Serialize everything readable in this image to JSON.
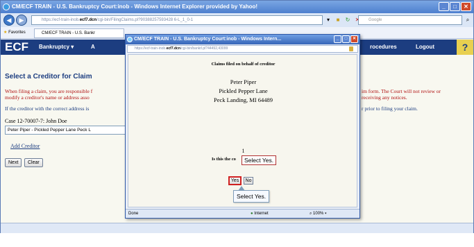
{
  "browser": {
    "title": "CM/ECF TRAIN - U.S. Bankruptcy Court:inob - Windows Internet Explorer provided by Yahoo!",
    "url_scheme": "https",
    "url_host": "ecf7.dcn",
    "url_rest": "/cgi-bin/FilingClaims.pl?90388257593428 6-L_1_0-1",
    "url_prefix": "://ecf-train-inob.",
    "search_placeholder": "Google",
    "favorites_label": "Favorites",
    "tab_label": "CM/ECF TRAIN - U.S. Bankr"
  },
  "ecf": {
    "logo": "ECF",
    "menu_bankruptcy": "Bankruptcy",
    "menu_adversary": "A",
    "menu_procedures": "rocedures",
    "menu_logout": "Logout",
    "help": "?"
  },
  "page": {
    "title": "Select a Creditor for Claim",
    "warning_line1_left": "When filing a claim, you are responsible f",
    "warning_line2_left": "modify a creditor's name or address asso",
    "warning_line1_right": "im form. The Court will not review or",
    "warning_line2_right": "receiving any notices.",
    "info_left": "If the creditor with the correct address is",
    "info_right": "r prior to filing your claim.",
    "case_line": "Case 12-70007-7: John Doe",
    "creditor_selected": "Peter Piper - Pickled Pepper Lane Peck L",
    "add_creditor": "Add Creditor",
    "next_label": "Next",
    "clear_label": "Clear"
  },
  "popup": {
    "title": "CM/ECF TRAIN - U.S. Bankruptcy Court:inob - Windows Intern...",
    "url_scheme": "https",
    "url_prefix": "://ecf-train-inob.",
    "url_host": "ecf7.dcn",
    "url_rest": "/cgi-bin/bankrl.pl?44492,43099",
    "heading": "Claims filed on behalf of creditor",
    "name": "Peter Piper",
    "street": "Pickled Pepper Lane",
    "city": "Peck Landing, MI 64489",
    "count": "1",
    "question": "Is this the co",
    "callout_top": "Select Yes.",
    "yes_label": "Yes",
    "no_label": "No",
    "callout_bottom": "Select Yes.",
    "status_done": "Done",
    "status_zone": "Internet",
    "status_zoom": "100%"
  }
}
